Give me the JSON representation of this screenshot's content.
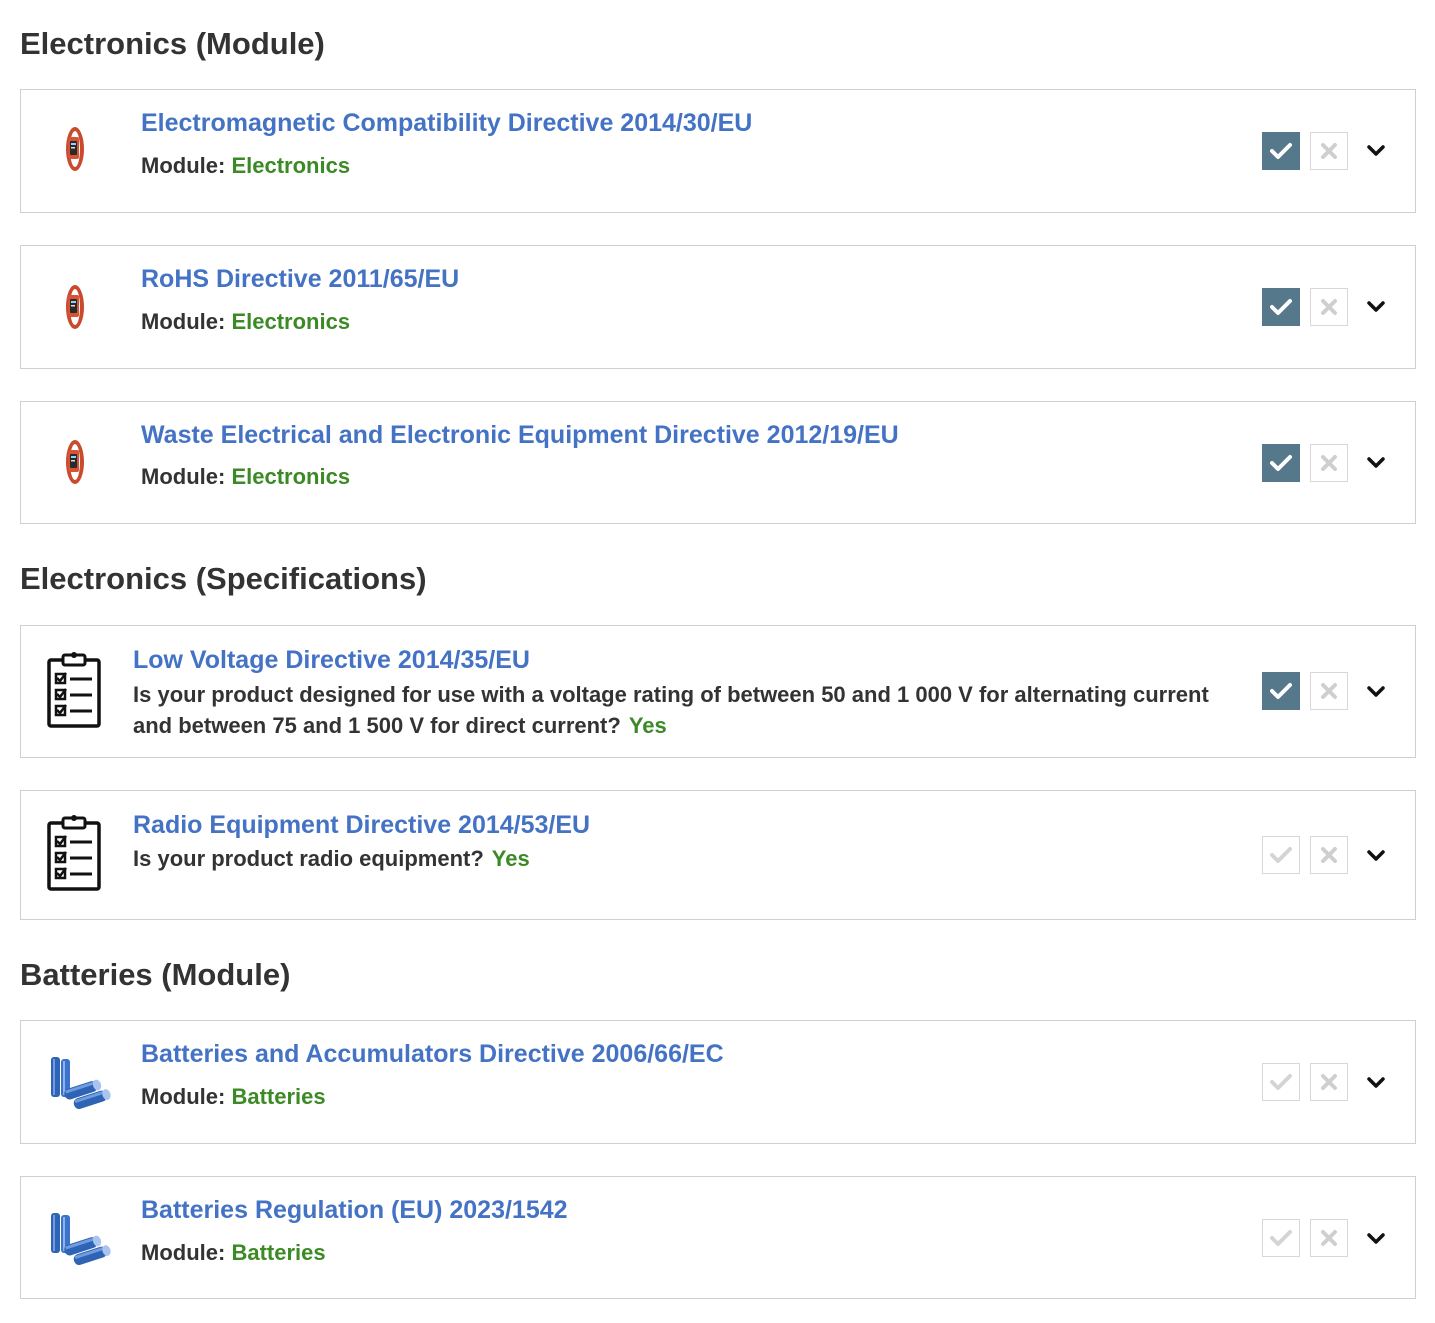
{
  "colors": {
    "link": "#4472c4",
    "value_green": "#3c8a25",
    "check_active": "#55798a",
    "text": "#333333"
  },
  "sections": [
    {
      "title": "Electronics (Module)",
      "items": [
        {
          "title": "Electromagnetic Compatibility Directive 2014/30/EU",
          "meta_label": "Module:",
          "meta_value": "Electronics",
          "icon": "fitness-band-icon",
          "checked": true
        },
        {
          "title": "RoHS Directive 2011/65/EU",
          "meta_label": "Module:",
          "meta_value": "Electronics",
          "icon": "fitness-band-icon",
          "checked": true
        },
        {
          "title": "Waste Electrical and Electronic Equipment Directive 2012/19/EU",
          "meta_label": "Module:",
          "meta_value": "Electronics",
          "icon": "fitness-band-icon",
          "checked": true
        }
      ]
    },
    {
      "title": "Electronics (Specifications)",
      "items": [
        {
          "title": "Low Voltage Directive 2014/35/EU",
          "question": "Is your product designed for use with a voltage rating of between 50 and 1 000 V for alternating current and between 75 and 1 500 V for direct current?",
          "answer": "Yes",
          "icon": "clipboard-checklist-icon",
          "checked": true
        },
        {
          "title": "Radio Equipment Directive 2014/53/EU",
          "question": "Is your product radio equipment?",
          "answer": "Yes",
          "icon": "clipboard-checklist-icon",
          "checked": false
        }
      ]
    },
    {
      "title": "Batteries (Module)",
      "items": [
        {
          "title": "Batteries and Accumulators Directive 2006/66/EC",
          "meta_label": "Module:",
          "meta_value": "Batteries",
          "icon": "batteries-icon",
          "checked": false
        },
        {
          "title": "Batteries Regulation (EU) 2023/1542",
          "meta_label": "Module:",
          "meta_value": "Batteries",
          "icon": "batteries-icon",
          "checked": false
        }
      ]
    }
  ]
}
